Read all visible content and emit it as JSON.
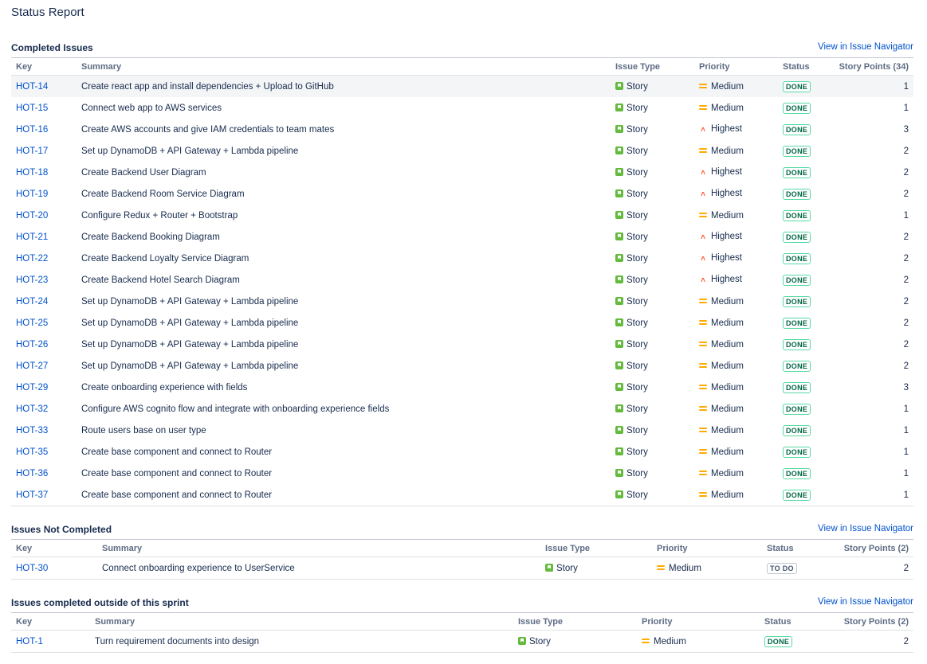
{
  "page_title": "Status Report",
  "nav_link": "View in Issue Navigator",
  "sections": {
    "completed": {
      "title": "Completed Issues",
      "headers": [
        "Key",
        "Summary",
        "Issue Type",
        "Priority",
        "Status",
        "Story Points (34)"
      ],
      "rows": [
        {
          "key": "HOT-14",
          "summary": "Create react app and install dependencies + Upload to GitHub",
          "type": "Story",
          "priority": "Medium",
          "status": "DONE",
          "points": "1"
        },
        {
          "key": "HOT-15",
          "summary": "Connect web app to AWS services",
          "type": "Story",
          "priority": "Medium",
          "status": "DONE",
          "points": "1"
        },
        {
          "key": "HOT-16",
          "summary": "Create AWS accounts and give IAM credentials to team mates",
          "type": "Story",
          "priority": "Highest",
          "status": "DONE",
          "points": "3"
        },
        {
          "key": "HOT-17",
          "summary": "Set up DynamoDB + API Gateway + Lambda pipeline",
          "type": "Story",
          "priority": "Medium",
          "status": "DONE",
          "points": "2"
        },
        {
          "key": "HOT-18",
          "summary": "Create Backend User Diagram",
          "type": "Story",
          "priority": "Highest",
          "status": "DONE",
          "points": "2"
        },
        {
          "key": "HOT-19",
          "summary": "Create Backend Room Service Diagram",
          "type": "Story",
          "priority": "Highest",
          "status": "DONE",
          "points": "2"
        },
        {
          "key": "HOT-20",
          "summary": "Configure Redux + Router + Bootstrap",
          "type": "Story",
          "priority": "Medium",
          "status": "DONE",
          "points": "1"
        },
        {
          "key": "HOT-21",
          "summary": "Create Backend Booking Diagram",
          "type": "Story",
          "priority": "Highest",
          "status": "DONE",
          "points": "2"
        },
        {
          "key": "HOT-22",
          "summary": "Create Backend Loyalty Service Diagram",
          "type": "Story",
          "priority": "Highest",
          "status": "DONE",
          "points": "2"
        },
        {
          "key": "HOT-23",
          "summary": "Create Backend Hotel Search Diagram",
          "type": "Story",
          "priority": "Highest",
          "status": "DONE",
          "points": "2"
        },
        {
          "key": "HOT-24",
          "summary": "Set up DynamoDB + API Gateway + Lambda pipeline",
          "type": "Story",
          "priority": "Medium",
          "status": "DONE",
          "points": "2"
        },
        {
          "key": "HOT-25",
          "summary": "Set up DynamoDB + API Gateway + Lambda pipeline",
          "type": "Story",
          "priority": "Medium",
          "status": "DONE",
          "points": "2"
        },
        {
          "key": "HOT-26",
          "summary": "Set up DynamoDB + API Gateway + Lambda pipeline",
          "type": "Story",
          "priority": "Medium",
          "status": "DONE",
          "points": "2"
        },
        {
          "key": "HOT-27",
          "summary": "Set up DynamoDB + API Gateway + Lambda pipeline",
          "type": "Story",
          "priority": "Medium",
          "status": "DONE",
          "points": "2"
        },
        {
          "key": "HOT-29",
          "summary": "Create onboarding experience with fields",
          "type": "Story",
          "priority": "Medium",
          "status": "DONE",
          "points": "3"
        },
        {
          "key": "HOT-32",
          "summary": "Configure AWS cognito flow and integrate with onboarding experience fields",
          "type": "Story",
          "priority": "Medium",
          "status": "DONE",
          "points": "1"
        },
        {
          "key": "HOT-33",
          "summary": "Route users base on user type",
          "type": "Story",
          "priority": "Medium",
          "status": "DONE",
          "points": "1"
        },
        {
          "key": "HOT-35",
          "summary": "Create base component and connect to Router",
          "type": "Story",
          "priority": "Medium",
          "status": "DONE",
          "points": "1"
        },
        {
          "key": "HOT-36",
          "summary": "Create base component and connect to Router",
          "type": "Story",
          "priority": "Medium",
          "status": "DONE",
          "points": "1"
        },
        {
          "key": "HOT-37",
          "summary": "Create base component and connect to Router",
          "type": "Story",
          "priority": "Medium",
          "status": "DONE",
          "points": "1"
        }
      ]
    },
    "not_completed": {
      "title": "Issues Not Completed",
      "headers": [
        "Key",
        "Summary",
        "Issue Type",
        "Priority",
        "Status",
        "Story Points (2)"
      ],
      "rows": [
        {
          "key": "HOT-30",
          "summary": "Connect onboarding experience to UserService",
          "type": "Story",
          "priority": "Medium",
          "status": "TO DO",
          "points": "2"
        }
      ]
    },
    "outside": {
      "title": "Issues completed outside of this sprint",
      "headers": [
        "Key",
        "Summary",
        "Issue Type",
        "Priority",
        "Status",
        "Story Points (2)"
      ],
      "rows": [
        {
          "key": "HOT-1",
          "summary": "Turn requirement documents into design",
          "type": "Story",
          "priority": "Medium",
          "status": "DONE",
          "points": "2"
        }
      ]
    }
  }
}
